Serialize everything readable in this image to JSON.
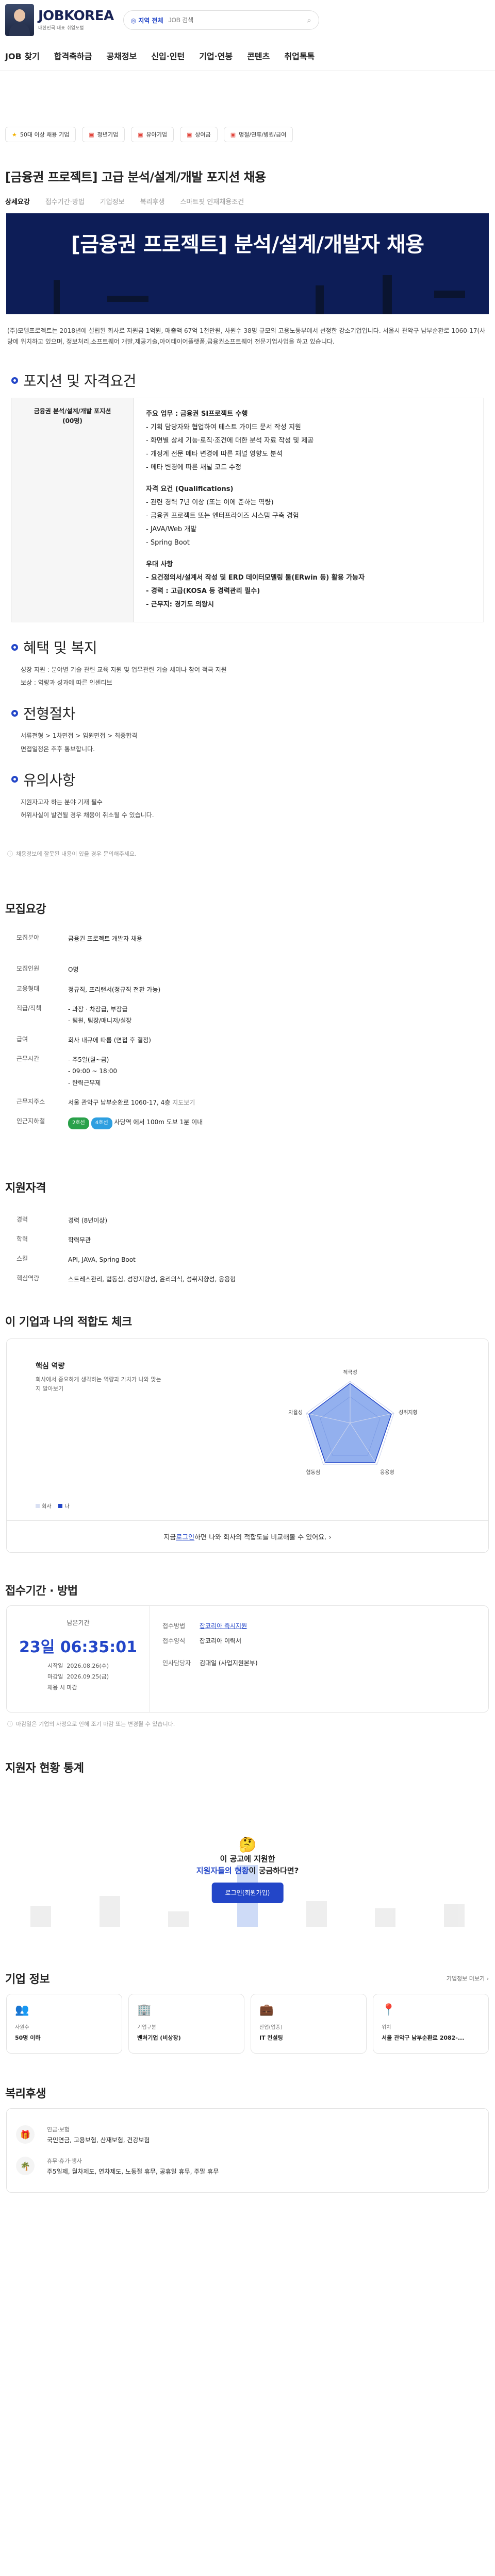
{
  "header": {
    "logo": "JOBKOREA",
    "logo_sub": "대한민국 대표 취업포털",
    "region": "◎ 지역 전체",
    "search_placeholder": "JOB 검색"
  },
  "gnb": [
    "JOB 찾기",
    "합격축하금",
    "공채정보",
    "신입·인턴",
    "기업·연봉",
    "콘텐츠",
    "취업톡톡"
  ],
  "chips": [
    "50대 이상 채용 기업",
    "청년기업",
    "유아기업",
    "상여금",
    "명절/연휴/병원/급여"
  ],
  "job": {
    "title": "[금융권 프로젝트] 고급 분석/설계/개발 포지션 채용",
    "tabs": [
      "상세요강",
      "접수기간·방법",
      "기업정보",
      "복리후생",
      "스마트핏 인재채용조건"
    ],
    "banner_title": "[금융권 프로젝트] 분석/설계/개발자 채용",
    "intro": "(주)모델프로젝트는 2018년에 설립된 회사로 지원금 1억원, 매출액 67억 1천만원, 사원수 38명 규모의 고용노동부에서 선정한 강소기업입니다. 서울시 관악구 남부순환로 1060-17(사당에 위치하고 있으며, 정보처리,소프트웨어 개발,제공기술,아이테이어플랫폼,금융권소프트웨어 전문기업사업을 하고 있습니다."
  },
  "position": {
    "heading": "포지션 및 자격요건",
    "left_title": "금융권 분석/설계/개발 포지션",
    "left_count": "(00명)",
    "duty_title": "주요 업무 : 금융권 SI프로젝트 수행",
    "duties": [
      "- 기획 담당자와 협업하여 테스트 가이드 문서 작성 지원",
      "- 화면별 상세 기능·로직·조건에 대한 분석 자료 작성 및 제공",
      "- 개정계 전문 메타 변경에 따른 채널 영향도 분석",
      "- 메타 변경에 따른 채널 코드 수정"
    ],
    "qual_title": "자격 요건 (Qualifications)",
    "quals": [
      "- 관련 경력 7년 이상 (또는 이에 준하는 역량)",
      "- 금융권 프로젝트 또는 엔터프라이즈 시스템 구축 경험",
      "- JAVA/Web 개발",
      "- Spring Boot"
    ],
    "pref_title": "우대 사항",
    "prefs": [
      "- 요건정의서/설계서 작성 및 ERD 데이터모델링 툴(ERwin 등) 활용 가능자",
      "- 경력 : 고급(KOSA 등 경력관리 필수)",
      "- 근무지: 경기도 의왕시"
    ]
  },
  "benefits": {
    "heading": "혜택 및 복지",
    "items": [
      "성장 지원 : 분야별 기술 관련 교육 지원 및 업무관련 기술 세미나 참여 적극 지원",
      "보상 : 역량과 성과에 따른 인센티브"
    ]
  },
  "process": {
    "heading": "전형절차",
    "items": [
      "서류전형 > 1차면접 > 임원면접 > 최종합격",
      "면접일정은 추후 통보합니다."
    ]
  },
  "caution": {
    "heading": "유의사항",
    "items": [
      "지원자고자 하는 분야 기재 필수",
      "허위사실이 발견될 경우 채용이 취소될 수 있습니다."
    ]
  },
  "notice": "채용정보에 잘못된 내용이 있을 경우 문의해주세요.",
  "summary": {
    "heading": "모집요강",
    "rows": [
      {
        "k": "모집분야",
        "v": "금융권 프로젝트 개발자 채용"
      },
      {
        "k": "모집인원",
        "v": "O명"
      },
      {
        "k": "고용형태",
        "v": "정규직, 프리랜서(정규직 전환 가능)"
      },
      {
        "k": "직급/직책",
        "v": "- 과장 · 차장급, 부장급"
      },
      {
        "k": "급여",
        "v": "회사 내규에 따름 (면접 후 결정)"
      },
      {
        "k": "근무시간",
        "v": "- 주5일(월~금)"
      },
      {
        "k": "근무지주소",
        "v": "서울 관악구 남부순환로 1060-17, 4층"
      },
      {
        "k": "인근지하철",
        "v": "사당역 에서 100m 도보 1분 이내"
      }
    ],
    "rank_sub": "- 팀원, 팀장/매니저/실장",
    "time_sub1": "- 09:00 ~ 18:00",
    "time_sub2": "- 탄력근무제",
    "map_link": "지도보기",
    "subway_tag1": "2호선",
    "subway_tag2": "4호선"
  },
  "qualification": {
    "heading": "지원자격",
    "rows": [
      {
        "k": "경력",
        "v": "경력 (8년이상)"
      },
      {
        "k": "학력",
        "v": "학력무관"
      },
      {
        "k": "스킬",
        "v": "API, JAVA, Spring Boot"
      },
      {
        "k": "핵심역량",
        "v": "스트레스관리, 협동심, 성장지향성, 윤리의식, 성취지향성, 응용형"
      }
    ]
  },
  "fit": {
    "heading": "이 기업과 나의 적합도 체크",
    "sub_title": "핵심 역량",
    "sub_desc": "회사에서 중요하게 생각하는 역량과 가치가 나와 맞는지 알아보기",
    "axes": [
      "적극성",
      "성취지향성",
      "응용형",
      "협동심",
      "자율성"
    ],
    "legend_company": "회사",
    "legend_me": "나",
    "cta_pre": "지금 ",
    "cta_link": "로그인",
    "cta_post": " 하면 나와 회사의 적합도를 비교해볼 수 있어요.  ›"
  },
  "apply": {
    "heading": "접수기간 · 방법",
    "left_label": "남은기간",
    "dday": "23일 06:35:01",
    "start_k": "시작일",
    "start_v": "2026.08.26(수)",
    "end_k": "마감일",
    "end_v": "2026.09.25(금)",
    "note": "채용 시 마감",
    "rows": [
      {
        "k": "접수방법",
        "v": "잡코리아 즉시지원"
      },
      {
        "k": "접수양식",
        "v": "잡코리아 이력서"
      },
      {
        "k": "인사담당자",
        "v": "김대일 (사업지원본부)"
      }
    ],
    "footnote": "마감일은 기업의 사정으로 인해 조기 마감 또는 변경될 수 있습니다."
  },
  "stats": {
    "heading": "지원자 현황 통계",
    "line1": "이 공고에 지원한",
    "line2_link": "지원자들의 현황",
    "line2_post": "이 궁금하다면?",
    "btn": "로그인(회원가입)"
  },
  "company": {
    "heading": "기업 정보",
    "more": "기업정보 더보기 ›",
    "items": [
      {
        "icon": "👥",
        "k": "사원수",
        "v": "50명 이하"
      },
      {
        "icon": "🏢",
        "k": "기업구분",
        "v": "벤처기업 (비상장)"
      },
      {
        "icon": "💼",
        "k": "산업(업종)",
        "v": "IT 컨설팅"
      },
      {
        "icon": "📍",
        "k": "위치",
        "v": "서울 관악구 남부순환로 2082-..."
      }
    ]
  },
  "welfare": {
    "heading": "복리후생",
    "rows": [
      {
        "icon": "🎁",
        "k": "연금·보험",
        "v": "국민연금, 고용보험, 산재보험, 건강보험"
      },
      {
        "icon": "🌴",
        "k": "휴무·휴가·행사",
        "v": "주5일제, 월차제도, 연차제도, 노동절 휴무, 공휴일 휴무, 주말 휴무"
      }
    ]
  },
  "colors": {
    "primary": "#2346c8",
    "banner": "#0d1d57"
  }
}
